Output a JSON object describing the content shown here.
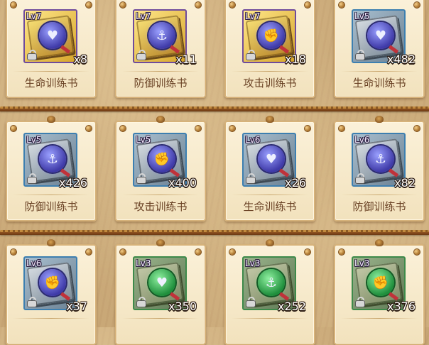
{
  "items": [
    {
      "level": "Lv7",
      "qty": "x8",
      "name": "生命训练书",
      "icon": "life-book-icon",
      "glyph": "♥",
      "tier": "purple"
    },
    {
      "level": "Lv7",
      "qty": "x11",
      "name": "防御训练书",
      "icon": "defense-book-icon",
      "glyph": "⚓",
      "tier": "purple"
    },
    {
      "level": "Lv7",
      "qty": "x18",
      "name": "攻击训练书",
      "icon": "attack-book-icon",
      "glyph": "✊",
      "tier": "purple"
    },
    {
      "level": "Lv5",
      "qty": "x482",
      "name": "生命训练书",
      "icon": "life-book-icon",
      "glyph": "♥",
      "tier": "blue"
    },
    {
      "level": "Lv5",
      "qty": "x426",
      "name": "防御训练书",
      "icon": "defense-book-icon",
      "glyph": "⚓",
      "tier": "blue"
    },
    {
      "level": "Lv5",
      "qty": "x400",
      "name": "攻击训练书",
      "icon": "attack-book-icon",
      "glyph": "✊",
      "tier": "blue"
    },
    {
      "level": "Lv6",
      "qty": "x26",
      "name": "生命训练书",
      "icon": "life-book-icon",
      "glyph": "♥",
      "tier": "blue"
    },
    {
      "level": "Lv6",
      "qty": "x82",
      "name": "防御训练书",
      "icon": "defense-book-icon",
      "glyph": "⚓",
      "tier": "blue"
    },
    {
      "level": "Lv6",
      "qty": "x37",
      "name": "",
      "icon": "attack-book-icon",
      "glyph": "✊",
      "tier": "blue"
    },
    {
      "level": "Lv3",
      "qty": "x350",
      "name": "",
      "icon": "life-book-icon",
      "glyph": "♥",
      "tier": "green"
    },
    {
      "level": "Lv3",
      "qty": "x252",
      "name": "",
      "icon": "defense-book-icon",
      "glyph": "⚓",
      "tier": "green"
    },
    {
      "level": "Lv3",
      "qty": "x376",
      "name": "",
      "icon": "attack-book-icon",
      "glyph": "✊",
      "tier": "green"
    }
  ],
  "tier_colors": {
    "purple": "#6f4b9c",
    "blue": "#3d7fb0",
    "green": "#3d8a4a"
  }
}
